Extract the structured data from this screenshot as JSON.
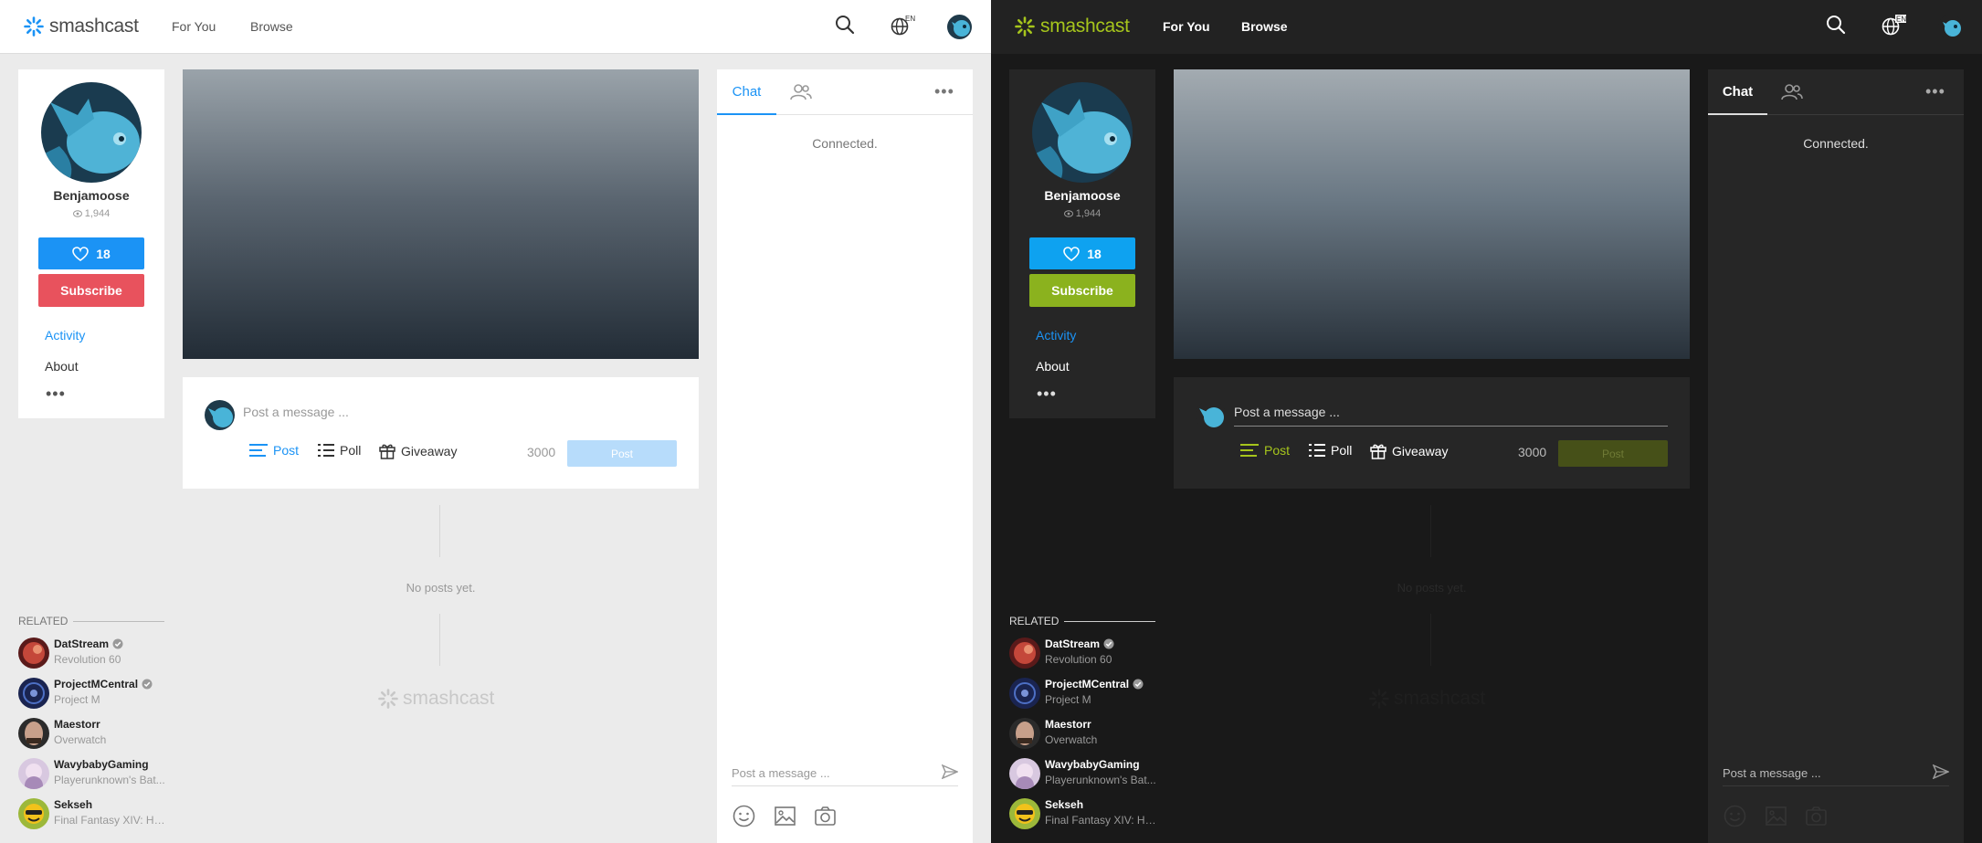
{
  "themes": {
    "light": {
      "name": "light"
    },
    "dark": {
      "name": "dark"
    }
  },
  "topbar": {
    "logo_text": "smashcast",
    "nav": [
      "For You",
      "Browse"
    ],
    "lang_badge": "EN",
    "icons": [
      "search-icon",
      "globe-icon"
    ]
  },
  "profile": {
    "username": "Benjamoose",
    "views": "1,944",
    "likes": "18",
    "subscribe_label": "Subscribe",
    "menu": [
      "Activity",
      "About"
    ],
    "more": "•••"
  },
  "post": {
    "placeholder": "Post a message ...",
    "tools": [
      "Post",
      "Poll",
      "Giveaway"
    ],
    "char_count": "3000",
    "submit_label": "Post"
  },
  "feed": {
    "empty_text": "No posts yet.",
    "watermark": "smashcast"
  },
  "related": {
    "heading": "RELATED",
    "items": [
      {
        "name": "DatStream",
        "game": "Revolution 60",
        "verified": true
      },
      {
        "name": "ProjectMCentral",
        "game": "Project M",
        "verified": true
      },
      {
        "name": "Maestorr",
        "game": "Overwatch",
        "verified": false
      },
      {
        "name": "WavybabyGaming",
        "game": "Playerunknown's Bat...",
        "verified": false
      },
      {
        "name": "Sekseh",
        "game": "Final Fantasy XIV: He...",
        "verified": false
      }
    ]
  },
  "chat": {
    "tab_label": "Chat",
    "status": "Connected.",
    "input_placeholder": "Post a message ...",
    "tools": [
      "emoji-icon",
      "image-icon",
      "camera-icon"
    ]
  },
  "colors": {
    "light_accent": "#1b93f5",
    "light_subscribe": "#e8525d",
    "dark_accent": "#a6c51c",
    "dark_like": "#0ea2f0"
  }
}
